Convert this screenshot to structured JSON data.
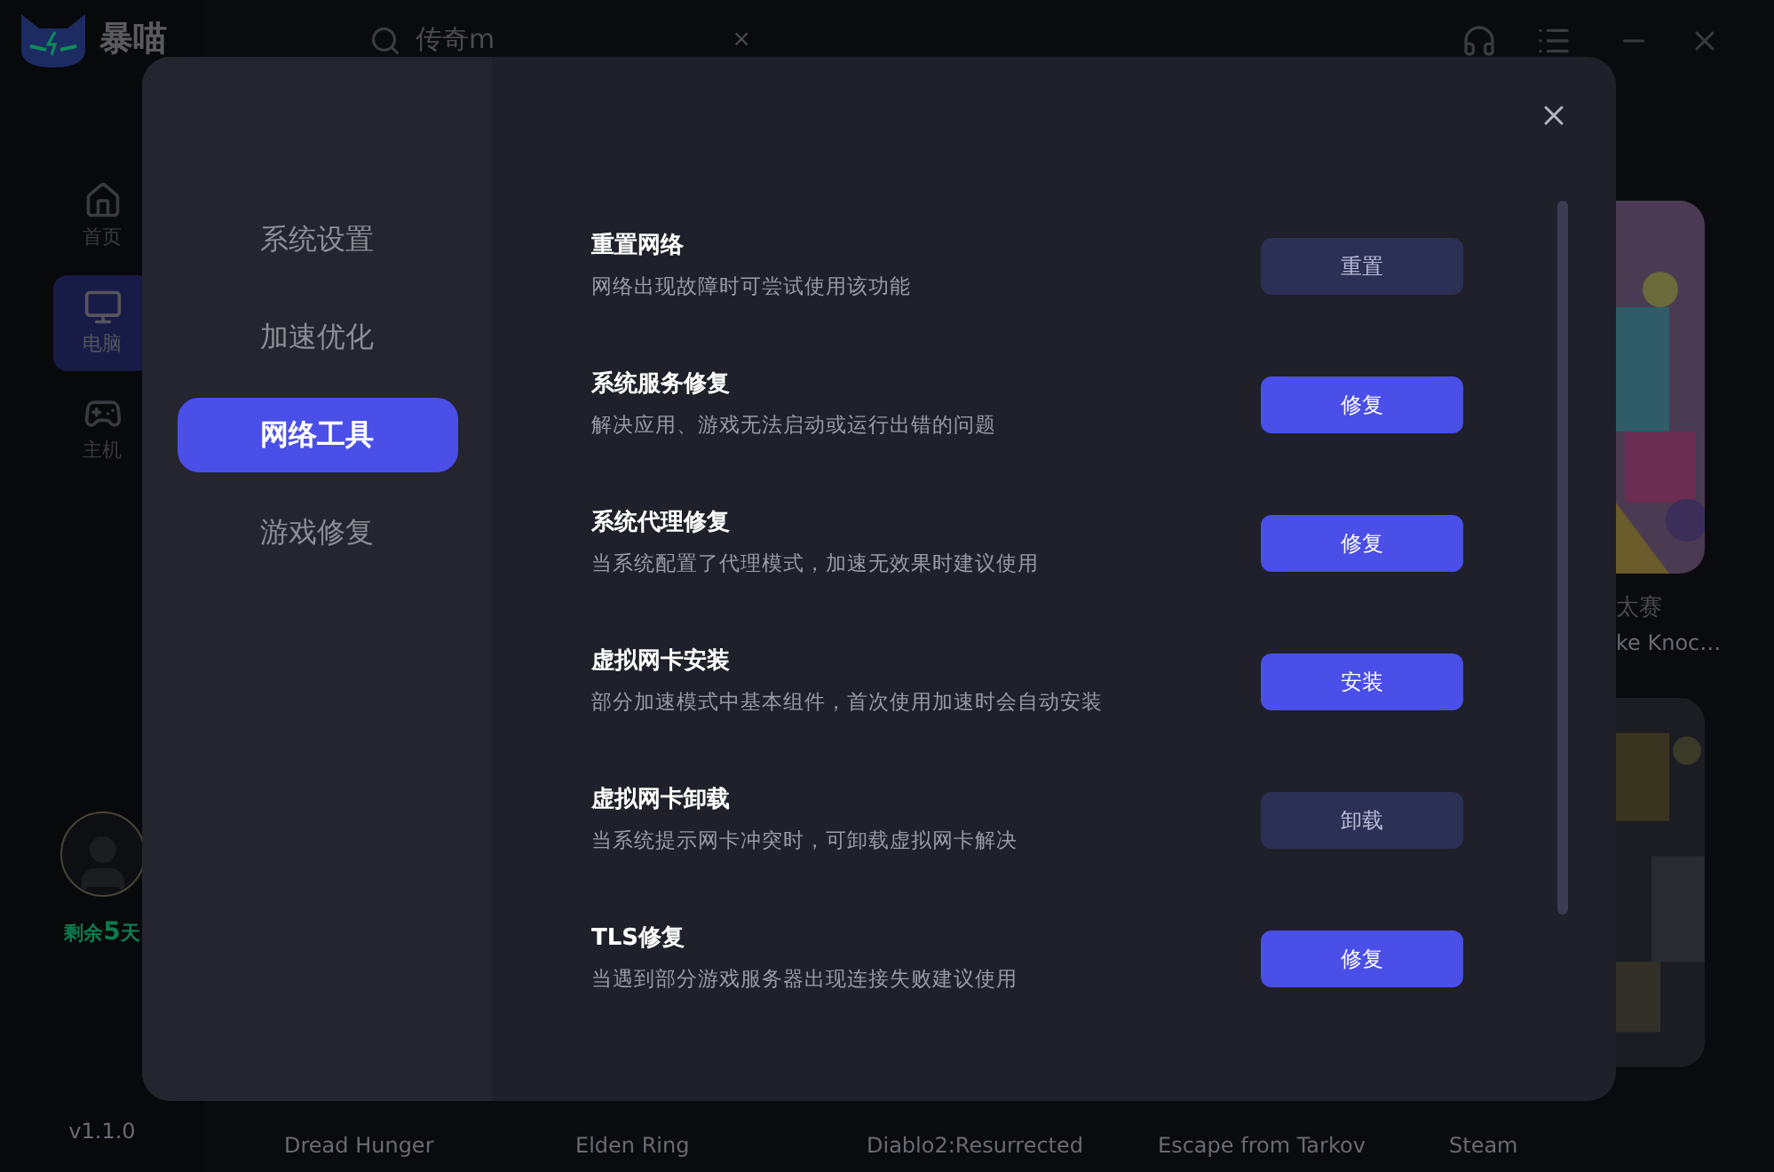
{
  "app": {
    "logo_text": "暴喵",
    "search": {
      "value": "传奇m",
      "clear": "×"
    },
    "nav": [
      {
        "label": "首页",
        "selected": false
      },
      {
        "label": "电脑",
        "selected": true
      },
      {
        "label": "主机",
        "selected": false
      }
    ],
    "remaining": {
      "prefix": "剩余",
      "number": "5",
      "suffix": "天"
    },
    "version": "v1.1.0",
    "side_game": {
      "title_fragment": "太赛",
      "subtitle_fragment": "ke Knoc…"
    },
    "bottom_games": [
      "Dread Hunger",
      "Elden Ring",
      "Diablo2:Resurrected",
      "Escape from Tarkov",
      "Steam"
    ]
  },
  "dialog": {
    "menu": [
      {
        "label": "系统设置",
        "selected": false
      },
      {
        "label": "加速优化",
        "selected": false
      },
      {
        "label": "网络工具",
        "selected": true
      },
      {
        "label": "游戏修复",
        "selected": false
      }
    ],
    "tools": [
      {
        "title": "重置网络",
        "description": "网络出现故障时可尝试使用该功能",
        "button": "重置",
        "primary": false
      },
      {
        "title": "系统服务修复",
        "description": "解决应用、游戏无法启动或运行出错的问题",
        "button": "修复",
        "primary": true
      },
      {
        "title": "系统代理修复",
        "description": "当系统配置了代理模式，加速无效果时建议使用",
        "button": "修复",
        "primary": true
      },
      {
        "title": "虚拟网卡安装",
        "description": "部分加速模式中基本组件，首次使用加速时会自动安装",
        "button": "安装",
        "primary": true
      },
      {
        "title": "虚拟网卡卸载",
        "description": "当系统提示网卡冲突时，可卸载虚拟网卡解决",
        "button": "卸载",
        "primary": false
      },
      {
        "title": "TLS修复",
        "description": "当遇到部分游戏服务器出现连接失败建议使用",
        "button": "修复",
        "primary": true
      }
    ]
  }
}
